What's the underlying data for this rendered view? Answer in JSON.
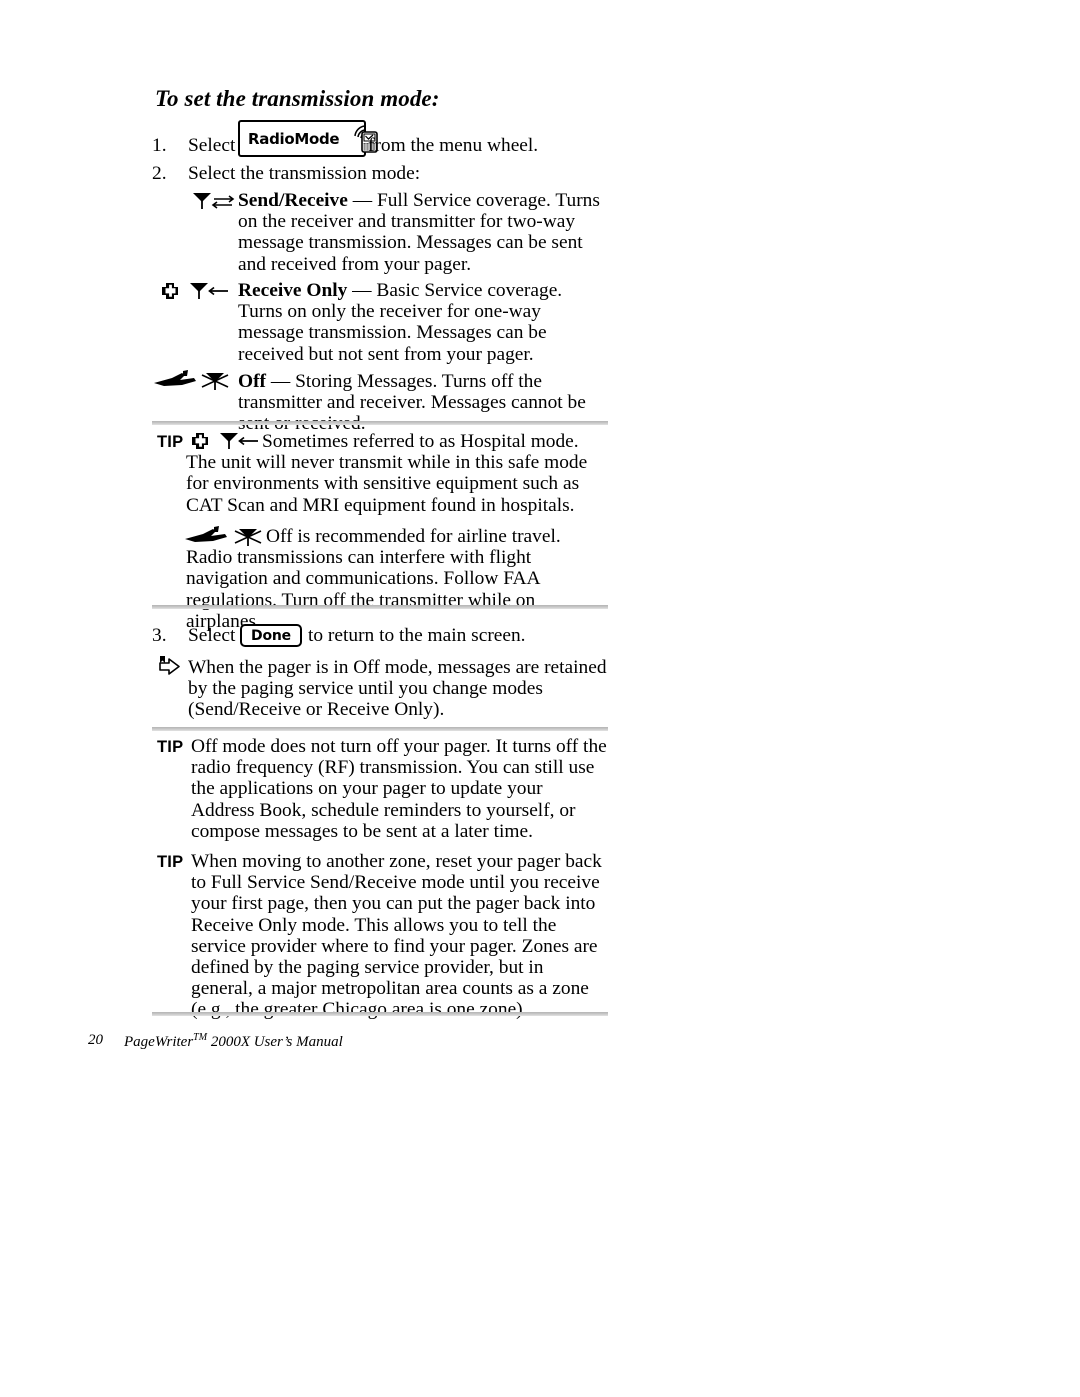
{
  "document": {
    "heading": "To set the transmission mode:",
    "footer": {
      "page_number": "20",
      "manual_title_pre": "PageWriter",
      "manual_title_tm": "TM",
      "manual_title_post": " 2000X User’s Manual"
    }
  },
  "steps": [
    {
      "number": "1.",
      "text_before": "Select",
      "button_label": "RadioMode",
      "text_after": "from the menu wheel."
    },
    {
      "number": "2.",
      "text_before": "Select the transmission mode:"
    },
    {
      "number": "3.",
      "text_before": "Select",
      "button_label": "Done",
      "text_after": "to return to the main screen."
    }
  ],
  "modes": [
    {
      "icon": "antenna-send-receive-icon",
      "title": "Send/Receive",
      "dash": " — ",
      "body": "Full Service coverage. Turns on the receiver and transmitter for two-way message transmission. Messages can be sent and received from your pager."
    },
    {
      "icon": "hospital-antenna-receive-icon",
      "title": "Receive Only",
      "dash": " — ",
      "body": "Basic Service coverage. Turns on only the receiver for one-way message transmission. Messages can be received but  not sent from your pager."
    },
    {
      "icon": "airplane-antenna-off-icon",
      "title": "Off",
      "dash": " — ",
      "body": "Storing Messages. Turns off the transmitter and receiver. Messages cannot be sent or received."
    }
  ],
  "tips": [
    {
      "label": "TIP",
      "icon": "hospital-antenna-receive-icon",
      "body": "Sometimes referred to as Hospital mode. The unit will never transmit while in this safe mode for environments with sensitive equipment such as CAT Scan and MRI equipment found in hospitals."
    },
    {
      "label": "",
      "icon": "airplane-antenna-off-icon",
      "body": "Off is recommended for airline travel. Radio transmissions can interfere with flight navigation and communications. Follow FAA regulations. Turn off the transmitter while on airplanes."
    },
    {
      "label": "TIP",
      "icon": "",
      "body": "Off mode does not turn off your pager. It turns off the radio frequency (RF) transmission. You can still use the applications on your pager to update your Address Book, schedule reminders to yourself, or compose messages to be sent at a later time."
    },
    {
      "label": "TIP",
      "icon": "",
      "body": "When moving to another zone, reset your pager back to Full Service Send/Receive mode until you receive your first page, then you can put the pager back into Receive Only mode. This allows you to tell the service provider where to find your pager. Zones are defined by the paging service provider, but in general, a major metropolitan area counts as a zone (e.g., the greater Chicago area is one zone)."
    }
  ],
  "notes": [
    {
      "icon": "pointing-hand-icon",
      "body": "When the pager is in Off mode, messages are retained by the paging service until you change modes (Send/Receive or Receive Only)."
    }
  ]
}
